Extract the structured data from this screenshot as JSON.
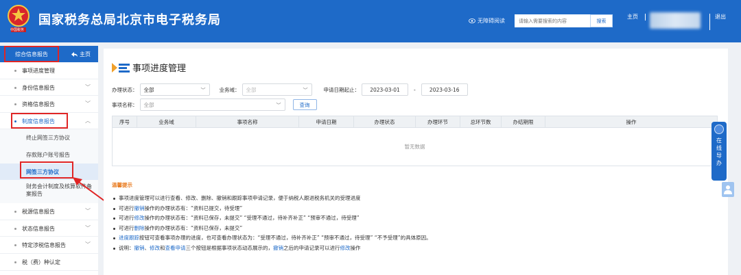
{
  "header": {
    "site_title": "国家税务总局北京市电子税务局",
    "emblem_text": "中国税务",
    "accessibility_label": "无障碍阅读",
    "search_placeholder": "请输入需要搜索的内容",
    "search_button": "搜索",
    "home_link": "主页",
    "separator": "|",
    "logout": "退出"
  },
  "sidebar": {
    "header_label": "综合信息报告",
    "home_label": "主页",
    "items": [
      {
        "label": "事项进度管理"
      },
      {
        "label": "身份信息报告"
      },
      {
        "label": "资格信息报告"
      },
      {
        "label": "制度信息报告"
      },
      {
        "label": "税源信息报告"
      },
      {
        "label": "状态信息报告"
      },
      {
        "label": "特定涉税信息报告"
      },
      {
        "label": "税（费）种认定"
      }
    ],
    "submenu": [
      {
        "label": "终止网签三方协议"
      },
      {
        "label": "存款账户账号报告"
      },
      {
        "label": "网签三方协议"
      },
      {
        "label": "财务会计制度及核算软件备案报告"
      }
    ]
  },
  "main": {
    "page_title": "事项进度管理",
    "filters": {
      "status_label": "办理状态：",
      "status_value": "全部",
      "domain_label": "业务域：",
      "domain_value": "全部",
      "date_label": "申请日期起止：",
      "date_from": "2023-03-01",
      "date_sep": "-",
      "date_to": "2023-03-16",
      "name_label": "事项名称：",
      "name_value": "全部",
      "query_button": "查询"
    },
    "table": {
      "columns": [
        "序号",
        "业务域",
        "事项名称",
        "申请日期",
        "办理状态",
        "办理环节",
        "总环节数",
        "办结期限",
        "操作"
      ],
      "empty_text": "暂无数据"
    },
    "tips": {
      "title": "温馨提示",
      "line1": "事项进度管理可以进行查看、修改、删除、撤销和跟踪事项申请记录，便于纳税人跟进税务机关的受理进度",
      "line2_pre": "可进行",
      "line2_hl": "撤销",
      "line2_post": "操作的办理状态有：“资料已提交，待受理”",
      "line3_pre": "可进行",
      "line3_hl": "修改",
      "line3_post": "操作的办理状态有：“资料已保存，未提交” “受理不通过，待补齐补正” “预审不通过，待受理”",
      "line4_pre": "可进行",
      "line4_hl": "删除",
      "line4_post": "操作的办理状态有：“资料已保存，未提交”",
      "line5_hl": "进度跟踪",
      "line5_post": "按钮可查看事项办理的进度，也可查看办理状态为：“受理不通过，待补齐补正” “预审不通过，待受理” “不予受理”的具体原因。",
      "line6_pre": "说明：",
      "line6_hl1": "撤销",
      "line6_mid1": "、",
      "line6_hl2": "修改",
      "line6_mid2": "和",
      "line6_hl3": "查看申请",
      "line6_mid3": "三个按钮是根据事项状态动态展示的，",
      "line6_hl4": "撤销",
      "line6_mid4": "之后的申请记录可以进行",
      "line6_hl5": "修改",
      "line6_post": "操作"
    }
  },
  "float_guide": {
    "chars": [
      "在",
      "线",
      "导",
      "办"
    ]
  },
  "colors": {
    "brand_blue": "#1e6ac8",
    "annotation_red": "#e02525",
    "tips_orange": "#e8791c"
  },
  "icons": [
    "national-emblem-icon",
    "eye-icon",
    "back-arrow-icon",
    "chevron-down-icon",
    "chevron-up-icon",
    "title-bars-icon",
    "robot-guide-icon",
    "person-icon"
  ]
}
